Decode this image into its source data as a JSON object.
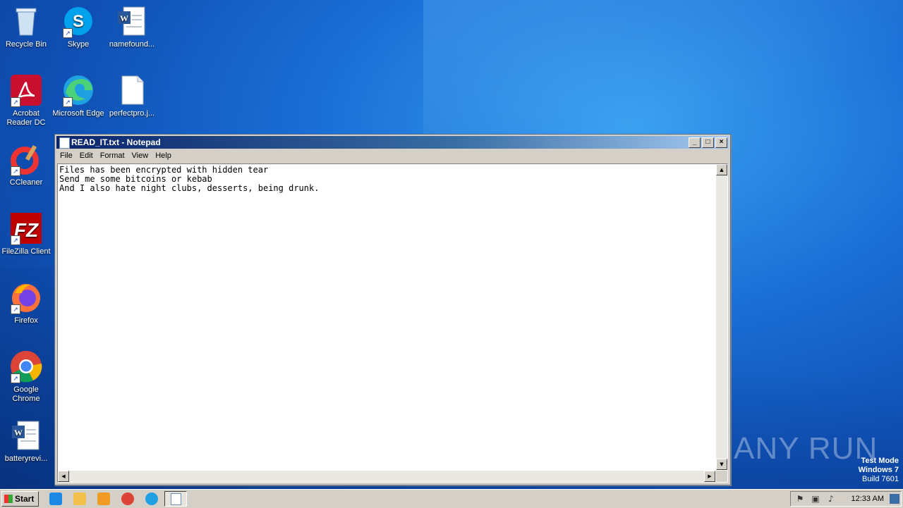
{
  "desktop": {
    "icons": [
      {
        "label": "Recycle Bin"
      },
      {
        "label": "Skype"
      },
      {
        "label": "namefound..."
      },
      {
        "label": "Acrobat Reader DC"
      },
      {
        "label": "Microsoft Edge"
      },
      {
        "label": "perfectpro.j..."
      },
      {
        "label": "CCleaner"
      },
      {
        "label": "FileZilla Client"
      },
      {
        "label": "Firefox"
      },
      {
        "label": "Google Chrome"
      },
      {
        "label": "batteryrevi..."
      }
    ]
  },
  "notepad": {
    "title": "READ_IT.txt - Notepad",
    "menu": [
      "File",
      "Edit",
      "Format",
      "View",
      "Help"
    ],
    "content": "Files has been encrypted with hidden tear\nSend me some bitcoins or kebab\nAnd I also hate night clubs, desserts, being drunk."
  },
  "watermark": {
    "brand": "ANY RUN",
    "mode_line1": "Test Mode",
    "mode_line2": "Windows 7",
    "mode_line3": "Build 7601"
  },
  "taskbar": {
    "start_label": "Start",
    "clock": "12:33 AM"
  },
  "colors": {
    "titlebar_start": "#0a246a",
    "titlebar_end": "#a6caf0",
    "chrome": "#d4d0c8"
  }
}
